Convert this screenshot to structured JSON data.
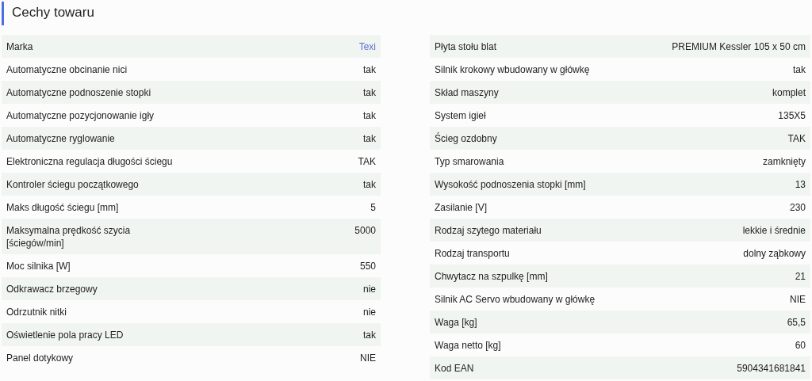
{
  "title": "Cechy towaru",
  "columns": [
    {
      "rows": [
        {
          "label": "Marka",
          "value": "Texi",
          "link": true
        },
        {
          "label": "Automatyczne obcinanie nici",
          "value": "tak"
        },
        {
          "label": "Automatyczne podnoszenie stopki",
          "value": "tak"
        },
        {
          "label": "Automatyczne pozycjonowanie igły",
          "value": "tak"
        },
        {
          "label": "Automatyczne ryglowanie",
          "value": "tak"
        },
        {
          "label": "Elektroniczna regulacja długości ściegu",
          "value": "TAK"
        },
        {
          "label": "Kontroler ściegu początkowego",
          "value": "tak"
        },
        {
          "label": "Maks długość ściegu [mm]",
          "value": "5"
        },
        {
          "label": "Maksymalna prędkość szycia [ściegów/min]",
          "value": "5000"
        },
        {
          "label": "Moc silnika [W]",
          "value": "550"
        },
        {
          "label": "Odkrawacz brzegowy",
          "value": "nie"
        },
        {
          "label": "Odrzutnik nitki",
          "value": "nie"
        },
        {
          "label": "Oświetlenie pola pracy LED",
          "value": "tak"
        },
        {
          "label": "Panel dotykowy",
          "value": "NIE"
        }
      ]
    },
    {
      "rows": [
        {
          "label": "Płyta stołu blat",
          "value": "PREMIUM Kessler 105 x 50 cm"
        },
        {
          "label": "Silnik krokowy wbudowany w główkę",
          "value": "tak"
        },
        {
          "label": "Skład maszyny",
          "value": "komplet"
        },
        {
          "label": "System igieł",
          "value": "135X5"
        },
        {
          "label": "Ścieg ozdobny",
          "value": "TAK"
        },
        {
          "label": "Typ smarowania",
          "value": "zamknięty"
        },
        {
          "label": "Wysokość podnoszenia stopki [mm]",
          "value": "13"
        },
        {
          "label": "Zasilanie [V]",
          "value": "230"
        },
        {
          "label": "Rodzaj szytego materiału",
          "value": "lekkie i średnie"
        },
        {
          "label": "Rodzaj transportu",
          "value": "dolny ząbkowy"
        },
        {
          "label": "Chwytacz na szpulkę [mm]",
          "value": "21"
        },
        {
          "label": "Silnik AC Servo wbudowany w główkę",
          "value": "NIE"
        },
        {
          "label": "Waga [kg]",
          "value": "65,5"
        },
        {
          "label": "Waga netto [kg]",
          "value": "60"
        },
        {
          "label": "Kod EAN",
          "value": "5904341681841"
        }
      ]
    }
  ]
}
